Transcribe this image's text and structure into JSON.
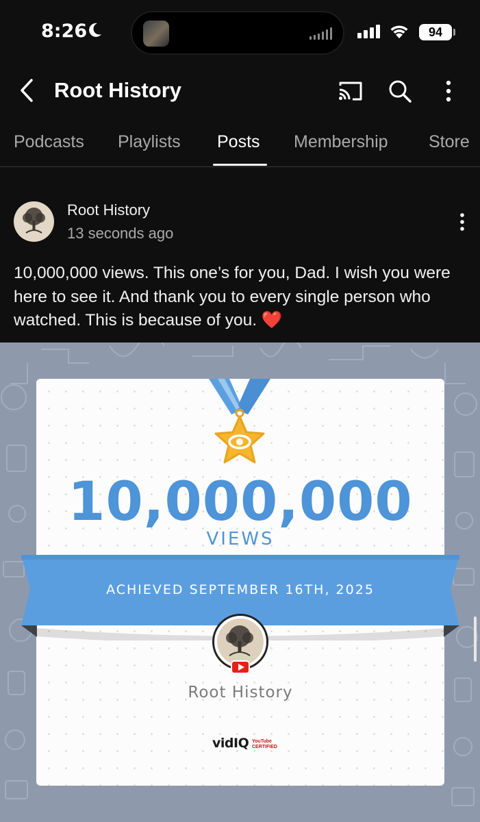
{
  "status_bar": {
    "time": "8:26",
    "battery": "94"
  },
  "header": {
    "channel_title": "Root History"
  },
  "tabs": [
    {
      "label": "Podcasts",
      "active": false
    },
    {
      "label": "Playlists",
      "active": false
    },
    {
      "label": "Posts",
      "active": true
    },
    {
      "label": "Membership",
      "active": false
    },
    {
      "label": "Store",
      "active": false
    }
  ],
  "post": {
    "author": "Root History",
    "timestamp": "13 seconds ago",
    "text": "10,000,000 views. This one’s for you, Dad. I wish you were here to see it. And thank you to every single person who watched. This is because of you.",
    "emoji": "❤️"
  },
  "milestone": {
    "count": "10,000,000",
    "unit": "VIEWS",
    "achieved": "ACHIEVED SEPTEMBER 16TH, 2025",
    "channel_name": "Root History",
    "brand": "vidIQ",
    "brand_sub": "YouTube CERTIFIED"
  },
  "colors": {
    "background": "#0f0f0f",
    "accent_blue": "#4d94d8",
    "medal_gold": "#f5b52e",
    "heart": "#e0102a"
  },
  "icons": [
    "moon-icon",
    "cellular-icon",
    "wifi-icon",
    "back-icon",
    "cast-icon",
    "search-icon",
    "more-icon",
    "medal-icon",
    "youtube-icon"
  ]
}
